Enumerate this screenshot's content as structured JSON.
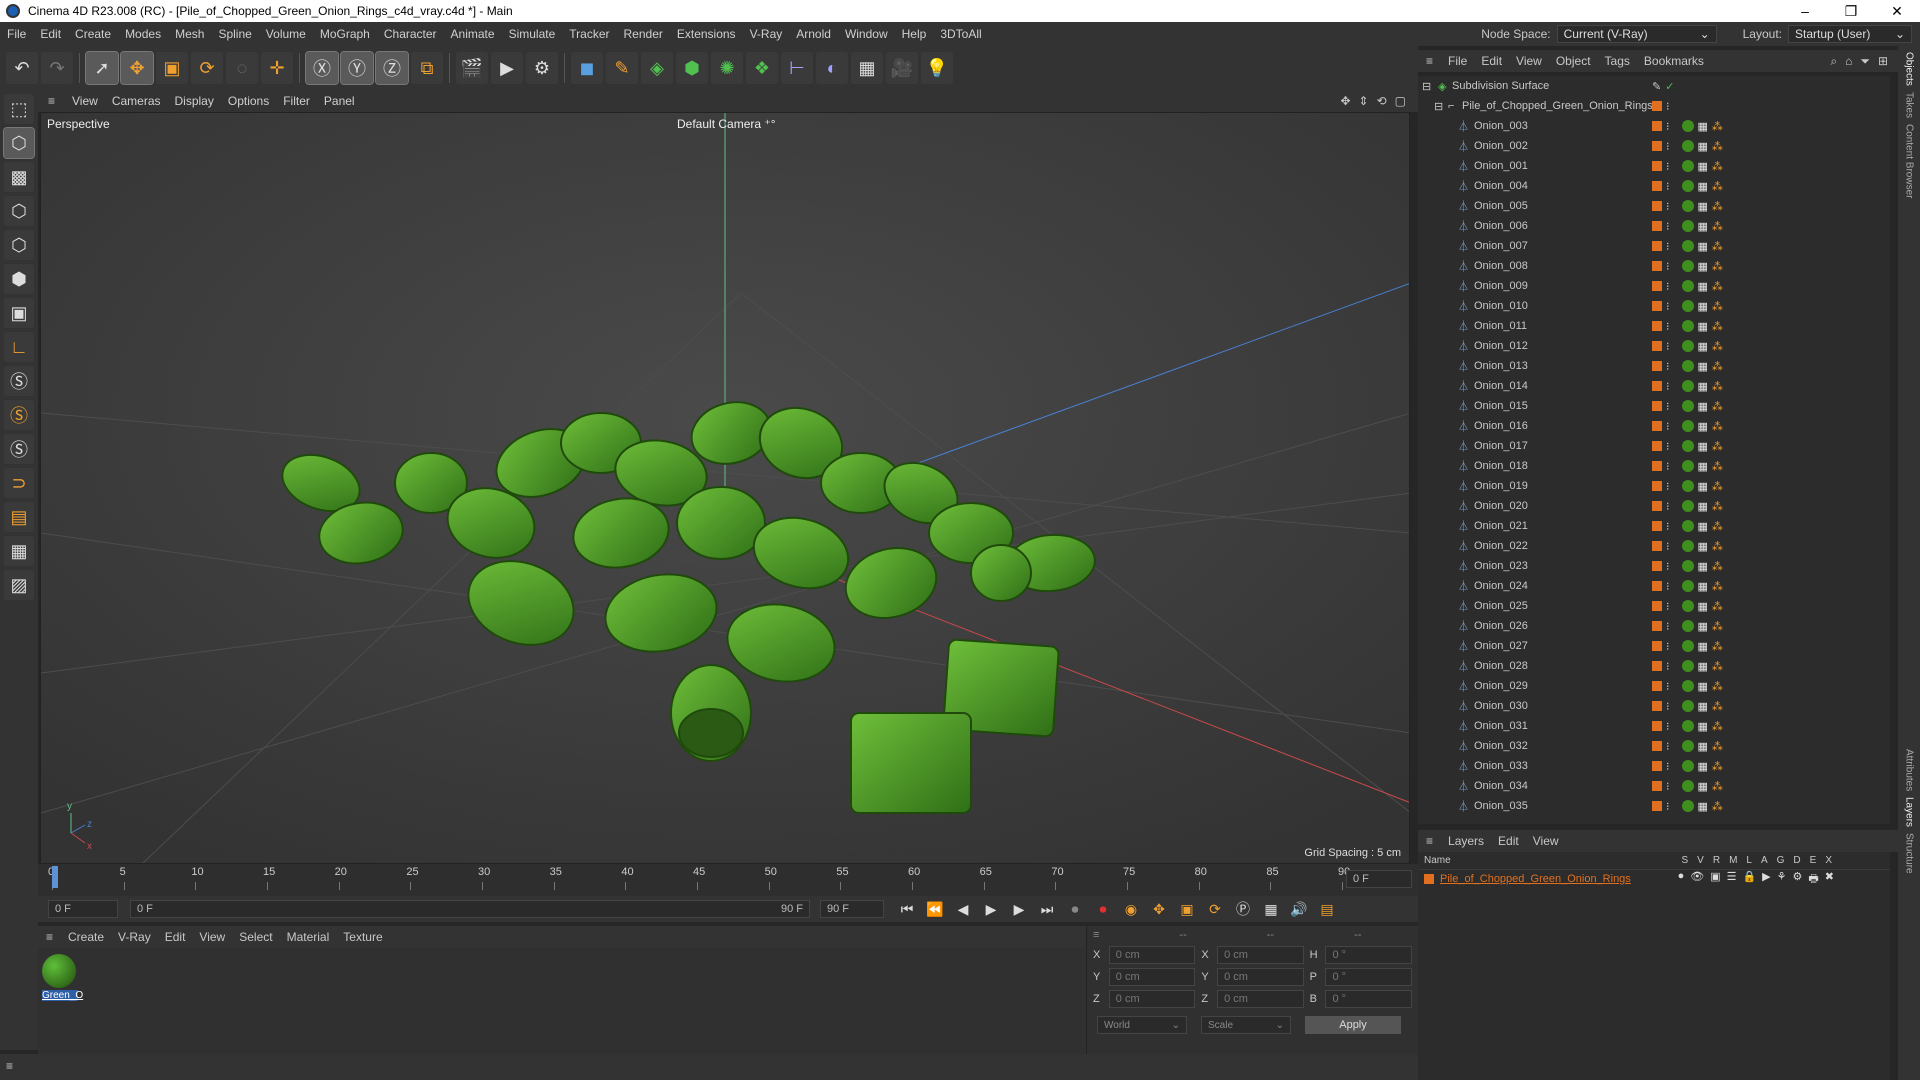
{
  "window": {
    "title": "Cinema 4D R23.008 (RC) - [Pile_of_Chopped_Green_Onion_Rings_c4d_vray.c4d *] - Main"
  },
  "menu": [
    "File",
    "Edit",
    "Create",
    "Modes",
    "Mesh",
    "Spline",
    "Volume",
    "MoGraph",
    "Character",
    "Animate",
    "Simulate",
    "Tracker",
    "Render",
    "Extensions",
    "V-Ray",
    "Arnold",
    "Window",
    "Help",
    "3DToAll"
  ],
  "nodespace": {
    "label": "Node Space:",
    "value": "Current (V-Ray)"
  },
  "layout": {
    "label": "Layout:",
    "value": "Startup (User)"
  },
  "viewport": {
    "menu": [
      "View",
      "Cameras",
      "Display",
      "Options",
      "Filter",
      "Panel"
    ],
    "view_name": "Perspective",
    "camera": "Default Camera",
    "grid_spacing": "Grid Spacing : 5 cm"
  },
  "timeline": {
    "ticks": [
      "0",
      "5",
      "10",
      "15",
      "20",
      "25",
      "30",
      "35",
      "40",
      "45",
      "50",
      "55",
      "60",
      "65",
      "70",
      "75",
      "80",
      "85",
      "90"
    ],
    "frame_end_field": "0 F",
    "start": "0 F",
    "range_start": "0 F",
    "range_end": "90 F",
    "end": "90 F"
  },
  "material": {
    "menu": [
      "Create",
      "V-Ray",
      "Edit",
      "View",
      "Select",
      "Material",
      "Texture"
    ],
    "items": [
      {
        "name": "Green_O"
      }
    ]
  },
  "coords": {
    "headers": [
      "--",
      "--",
      "--"
    ],
    "rows": [
      {
        "a": "X",
        "av": "0 cm",
        "b": "X",
        "bv": "0 cm",
        "c": "H",
        "cv": "0 °"
      },
      {
        "a": "Y",
        "av": "0 cm",
        "b": "Y",
        "bv": "0 cm",
        "c": "P",
        "cv": "0 °"
      },
      {
        "a": "Z",
        "av": "0 cm",
        "b": "Z",
        "bv": "0 cm",
        "c": "B",
        "cv": "0 °"
      }
    ],
    "mode1": "World",
    "mode2": "Scale",
    "apply": "Apply"
  },
  "objects": {
    "menu": [
      "File",
      "Edit",
      "View",
      "Object",
      "Tags",
      "Bookmarks"
    ],
    "root": "Subdivision Surface",
    "group": "Pile_of_Chopped_Green_Onion_Rings",
    "items": [
      "Onion_003",
      "Onion_002",
      "Onion_001",
      "Onion_004",
      "Onion_005",
      "Onion_006",
      "Onion_007",
      "Onion_008",
      "Onion_009",
      "Onion_010",
      "Onion_011",
      "Onion_012",
      "Onion_013",
      "Onion_014",
      "Onion_015",
      "Onion_016",
      "Onion_017",
      "Onion_018",
      "Onion_019",
      "Onion_020",
      "Onion_021",
      "Onion_022",
      "Onion_023",
      "Onion_024",
      "Onion_025",
      "Onion_026",
      "Onion_027",
      "Onion_028",
      "Onion_029",
      "Onion_030",
      "Onion_031",
      "Onion_032",
      "Onion_033",
      "Onion_034",
      "Onion_035"
    ]
  },
  "layers": {
    "menu": [
      "Layers",
      "Edit",
      "View"
    ],
    "col_name": "Name",
    "cols": [
      "S",
      "V",
      "R",
      "M",
      "L",
      "A",
      "G",
      "D",
      "E",
      "X"
    ],
    "items": [
      {
        "name": "Pile_of_Chopped_Green_Onion_Rings",
        "color": "#e07020"
      }
    ]
  },
  "side_tabs": [
    "Objects",
    "Takes",
    "Content Browser",
    "Attributes",
    "Layers",
    "Structure"
  ],
  "colors": {
    "accent_orange": "#e07020",
    "onion_green": "#3f8f1f",
    "selection": "#5b93d6"
  }
}
